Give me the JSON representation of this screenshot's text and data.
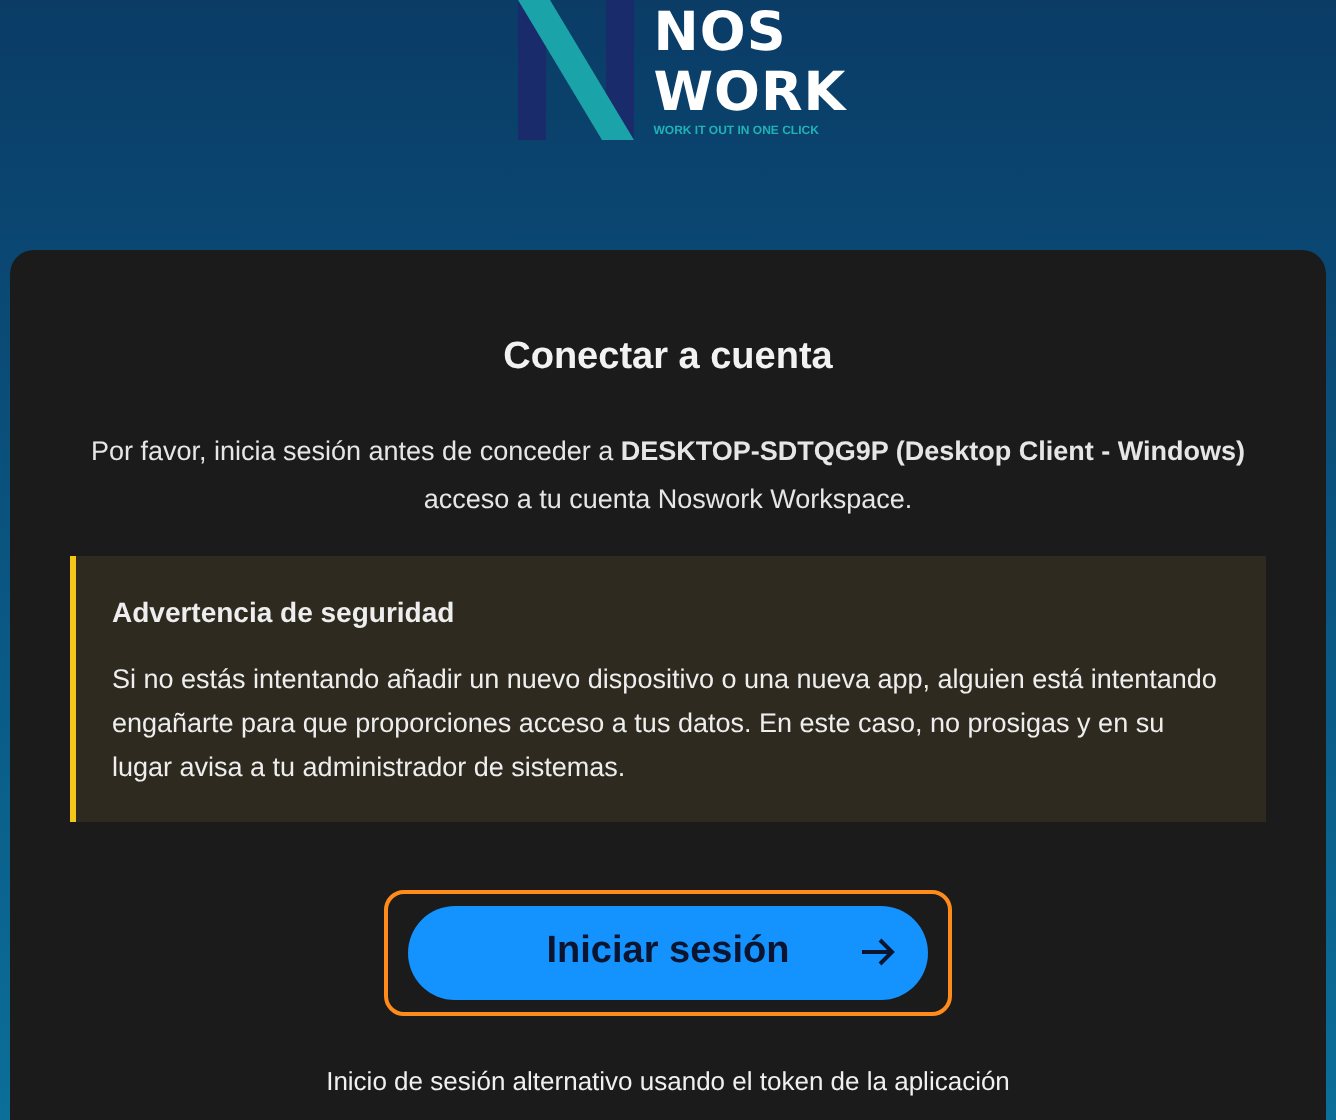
{
  "logo": {
    "line_1": "NOS",
    "line_2": "WORK",
    "tagline": "WORK IT OUT IN ONE CLICK"
  },
  "card": {
    "title": "Conectar a cuenta",
    "description": "Por favor, inicia sesión antes de conceder a **DESKTOP-SDTQG9P (Desktop Client - Windows)** acceso a tu cuenta Noswork Workspace.",
    "warning": {
      "title": "Advertencia de seguridad",
      "text": "Si no estás intentando añadir un nuevo dispositivo o una nueva app, alguien está intentando engañarte para que proporciones acceso a tus datos. En este caso, no prosigas y en su lugar avisa a tu administrador de sistemas."
    },
    "button": {
      "label": "Iniciar sesión",
      "focused": true
    },
    "alt_link": "Inicio de sesión alternativo usando el token de la aplicación"
  }
}
